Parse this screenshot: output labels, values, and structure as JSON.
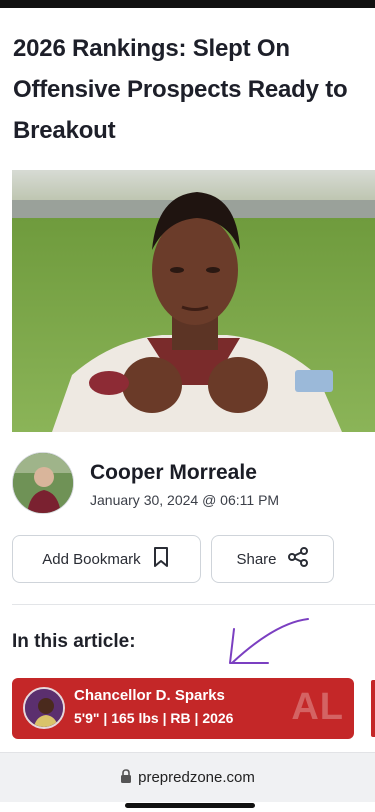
{
  "article": {
    "title": "2026 Rankings: Slept On Offensive Prospects Ready to Breakout"
  },
  "author": {
    "name": "Cooper Morreale",
    "date": "January 30, 2024 @ 06:11 PM"
  },
  "actions": {
    "bookmark_label": "Add Bookmark",
    "share_label": "Share"
  },
  "in_article": {
    "heading": "In this article:",
    "players": [
      {
        "name": "Chancellor D. Sparks",
        "info": "5'9\" | 165 lbs | RB | 2026",
        "state": "AL"
      }
    ]
  },
  "browser": {
    "url": "prepredzone.com"
  },
  "colors": {
    "card_red": "#c42728",
    "annotation": "#7b3fc1"
  }
}
